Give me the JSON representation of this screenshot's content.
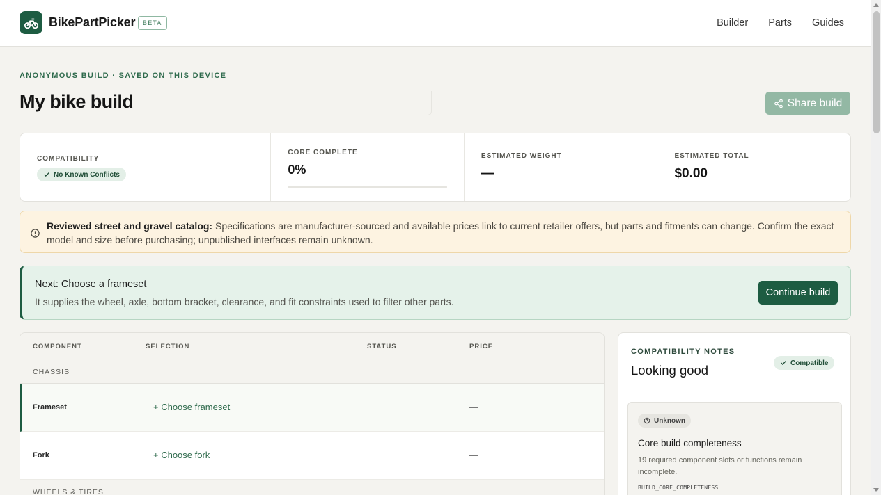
{
  "header": {
    "brand": "BikePartPicker",
    "badge": "BETA",
    "nav": [
      "Builder",
      "Parts",
      "Guides"
    ]
  },
  "page": {
    "eyebrow": "ANONYMOUS BUILD · SAVED ON THIS DEVICE",
    "title": "My bike build",
    "share_label": "Share build"
  },
  "stats": {
    "compatibility_label": "COMPATIBILITY",
    "compatibility_value": "No Known Conflicts",
    "core_label": "CORE COMPLETE",
    "core_value": "0%",
    "core_progress": 0,
    "weight_label": "ESTIMATED WEIGHT",
    "weight_value": "—",
    "total_label": "ESTIMATED TOTAL",
    "total_value": "$0.00"
  },
  "notice": {
    "bold": "Reviewed street and gravel catalog:",
    "text": " Specifications are manufacturer-sourced and available prices link to current retailer offers, but parts and fitments can change. Confirm the exact model and size before purchasing; unpublished interfaces remain unknown."
  },
  "next": {
    "title": "Next: Choose a frameset",
    "desc": "It supplies the wheel, axle, bottom bracket, clearance, and fit constraints used to filter other parts.",
    "button": "Continue build"
  },
  "table": {
    "headers": [
      "COMPONENT",
      "SELECTION",
      "STATUS",
      "PRICE"
    ],
    "groups": [
      "CHASSIS",
      "WHEELS & TIRES"
    ],
    "rows": [
      {
        "name": "Frameset",
        "selection": "+ Choose frameset",
        "price": "—"
      },
      {
        "name": "Fork",
        "selection": "+ Choose fork",
        "price": "—"
      }
    ]
  },
  "notes": {
    "label": "COMPATIBILITY NOTES",
    "title": "Looking good",
    "badge": "Compatible",
    "card": {
      "status": "Unknown",
      "title": "Core build completeness",
      "desc": "19 required component slots or functions remain incomplete.",
      "code": "BUILD_CORE_COMPLETENESS"
    }
  },
  "colors": {
    "brand": "#1d5c42",
    "accent_light": "#e5f2ea",
    "notice_bg": "#fdf3e1"
  }
}
